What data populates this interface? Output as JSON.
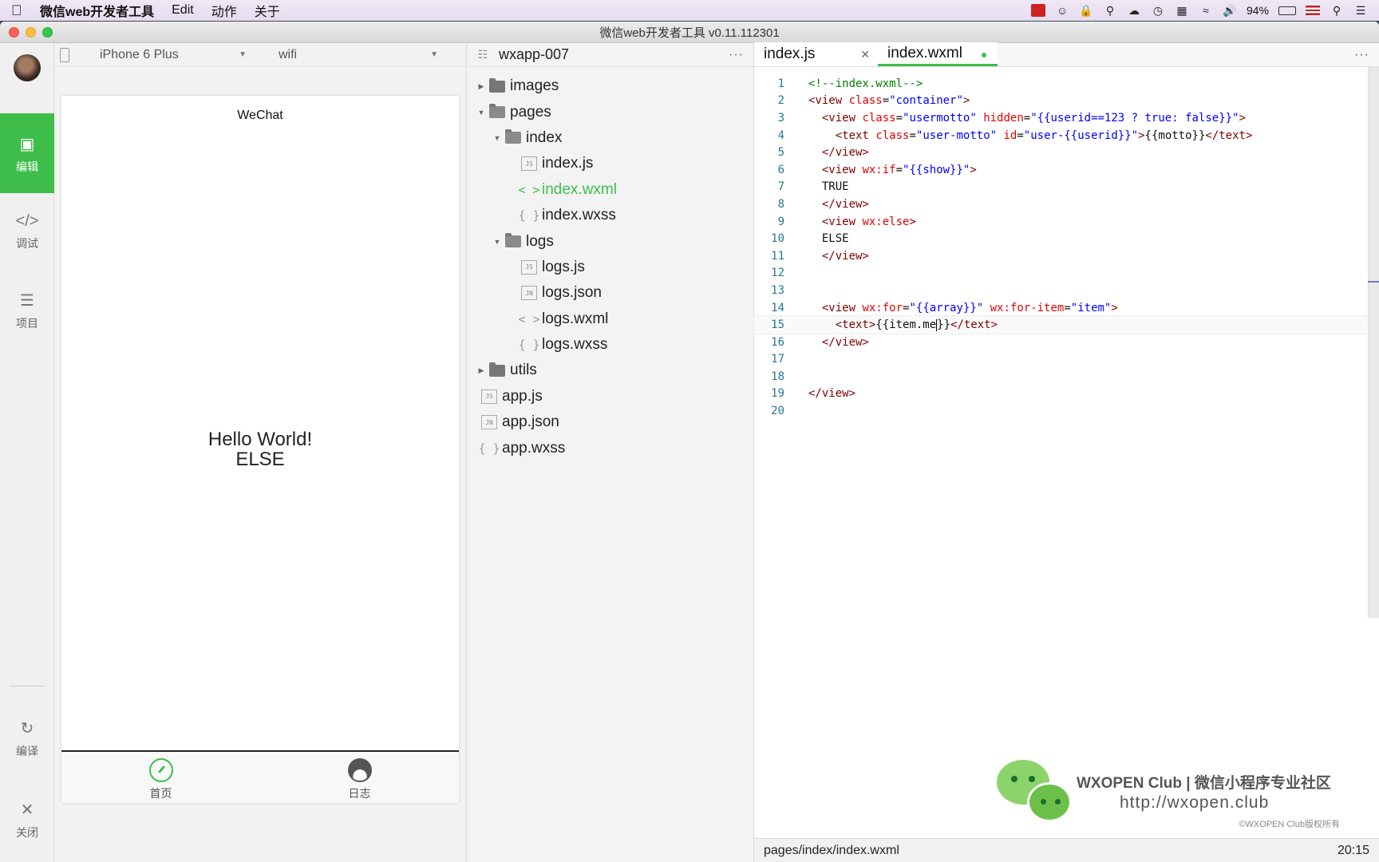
{
  "menubar": {
    "apple": "",
    "items": [
      "微信web开发者工具",
      "Edit",
      "动作",
      "关于"
    ],
    "battery": "94%"
  },
  "window": {
    "title": "微信web开发者工具 v0.11.112301"
  },
  "rail": {
    "items": [
      {
        "label": "编辑",
        "icon": "code-icon"
      },
      {
        "label": "调试",
        "icon": "debug-icon"
      },
      {
        "label": "项目",
        "icon": "list-icon"
      },
      {
        "label": "编译",
        "icon": "compile-icon"
      },
      {
        "label": "关闭",
        "icon": "close-icon"
      }
    ]
  },
  "simulator": {
    "device": "iPhone 6 Plus",
    "network": "wifi",
    "nav_title": "WeChat",
    "content_line1": "Hello World!",
    "content_line2": "ELSE",
    "tabbar": [
      {
        "label": "首页"
      },
      {
        "label": "日志"
      }
    ]
  },
  "tree": {
    "project": "wxapp-007",
    "more": "···",
    "nodes": [
      {
        "label": "images"
      },
      {
        "label": "pages"
      },
      {
        "label": "index"
      },
      {
        "label": "index.js",
        "badge": "JS"
      },
      {
        "label": "index.wxml",
        "badge": "< >"
      },
      {
        "label": "index.wxss",
        "badge": "{ }"
      },
      {
        "label": "logs"
      },
      {
        "label": "logs.js",
        "badge": "JS"
      },
      {
        "label": "logs.json",
        "badge": "JN"
      },
      {
        "label": "logs.wxml",
        "badge": "< >"
      },
      {
        "label": "logs.wxss",
        "badge": "{ }"
      },
      {
        "label": "utils"
      },
      {
        "label": "app.js",
        "badge": "JS"
      },
      {
        "label": "app.json",
        "badge": "JN"
      },
      {
        "label": "app.wxss",
        "badge": "{ }"
      }
    ]
  },
  "editor": {
    "tabs": [
      {
        "label": "index.js"
      },
      {
        "label": "index.wxml"
      }
    ],
    "more": "···",
    "line_numbers": [
      "1",
      "2",
      "3",
      "4",
      "5",
      "6",
      "7",
      "8",
      "9",
      "10",
      "11",
      "12",
      "13",
      "14",
      "15",
      "16",
      "17",
      "18",
      "19",
      "20"
    ],
    "status_path": "pages/index/index.wxml",
    "status_pos": "20:15"
  },
  "watermark": {
    "title": "WXOPEN Club | 微信小程序专业社区",
    "url": "http://wxopen.club",
    "copyright": "©WXOPEN Club版权所有"
  }
}
